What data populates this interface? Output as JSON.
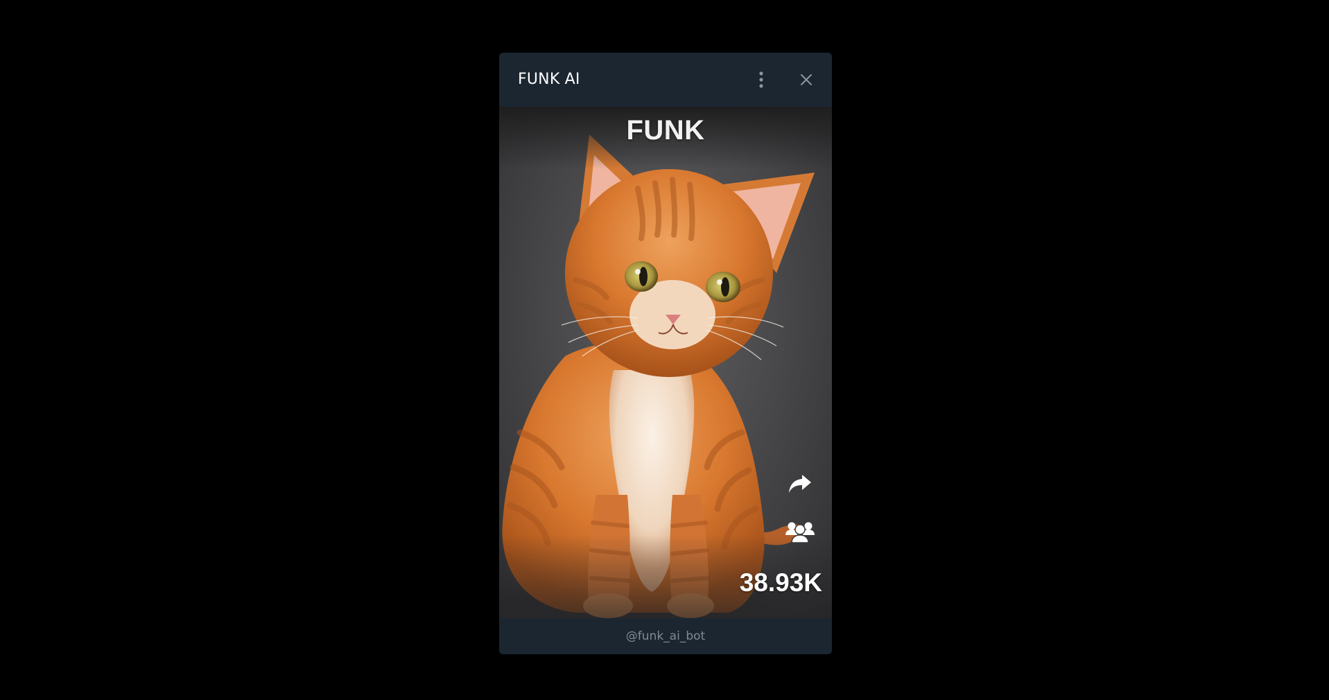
{
  "window": {
    "title": "FUNK AI",
    "menu_icon": "more-vertical-icon",
    "close_icon": "close-icon"
  },
  "content": {
    "brand": "FUNK",
    "image_subject": "orange-kitten",
    "share_icon": "share-arrow-icon",
    "group_icon": "users-group-icon",
    "count": "38.93K"
  },
  "footer": {
    "bot_handle": "@funk_ai_bot"
  },
  "colors": {
    "page_background": "#000000",
    "chrome": "#1b2631",
    "title_text": "#ffffff",
    "footer_text": "#7f8b96",
    "cat_orange": "#d9782f"
  }
}
